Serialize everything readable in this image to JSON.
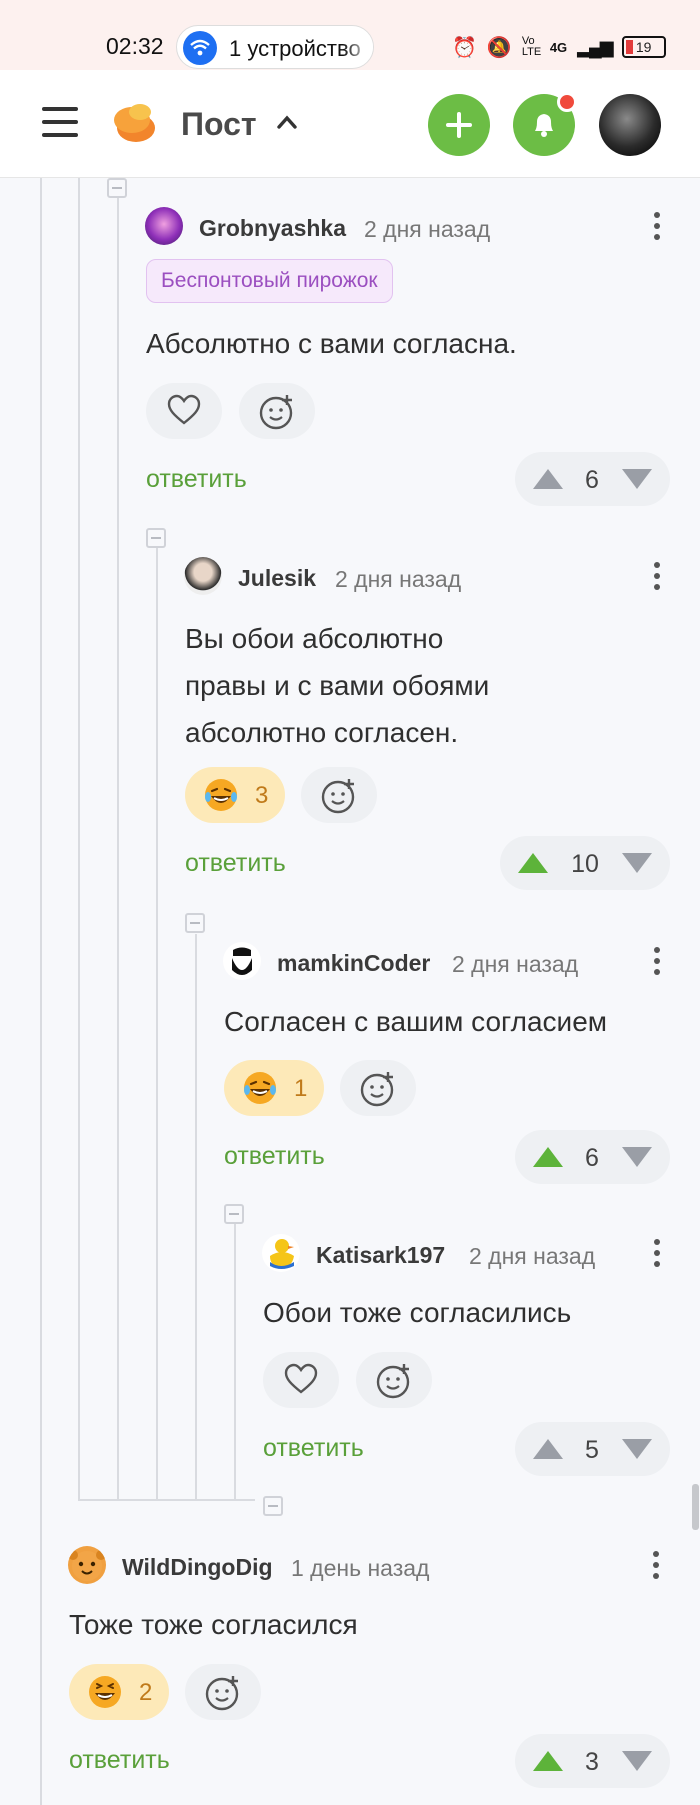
{
  "status_bar": {
    "time": "02:32",
    "pill_text": "1 устройство",
    "signal_text": "4G",
    "volte_text": "Vo LTE",
    "battery": "19"
  },
  "header": {
    "title": "Пост"
  },
  "colors": {
    "accent_green": "#6cbd45",
    "reply_green": "#5aa03a",
    "upvote_active": "#5db33a",
    "vote_inactive": "#9a9ea6",
    "badge_purple": "#9b4fc0",
    "notification_red": "#f04a3c"
  },
  "comments": [
    {
      "user": "Grobnyashka",
      "time": "2 дня назад",
      "badge": "Беспонтовый пирожок",
      "text": "Абсолютно с вами согласна.",
      "reaction_icon": "heart-icon",
      "reaction_count": "",
      "reply": "ответить",
      "votes": "6",
      "vote_state": "none"
    },
    {
      "user": "Julesik",
      "time": "2 дня назад",
      "text_lines": [
        "Вы обои абсолютно",
        "правы и с вами обоями",
        "абсолютно согласен."
      ],
      "reaction_icon": "laughing-emoji-icon",
      "reaction_count": "3",
      "reply": "ответить",
      "votes": "10",
      "vote_state": "up"
    },
    {
      "user": "mamkinCoder",
      "time": "2 дня назад",
      "text": "Согласен с вашим согласием",
      "reaction_icon": "laughing-emoji-icon",
      "reaction_count": "1",
      "reply": "ответить",
      "votes": "6",
      "vote_state": "up"
    },
    {
      "user": "Katisark197",
      "time": "2 дня назад",
      "text": "Обои тоже согласились",
      "reaction_icon": "heart-icon",
      "reaction_count": "",
      "reply": "ответить",
      "votes": "5",
      "vote_state": "none"
    },
    {
      "user": "WildDingoDig",
      "time": "1 день назад",
      "text": "Тоже тоже согласился",
      "reaction_icon": "grinning-emoji-icon",
      "reaction_count": "2",
      "reply": "ответить",
      "votes": "3",
      "vote_state": "up"
    }
  ]
}
